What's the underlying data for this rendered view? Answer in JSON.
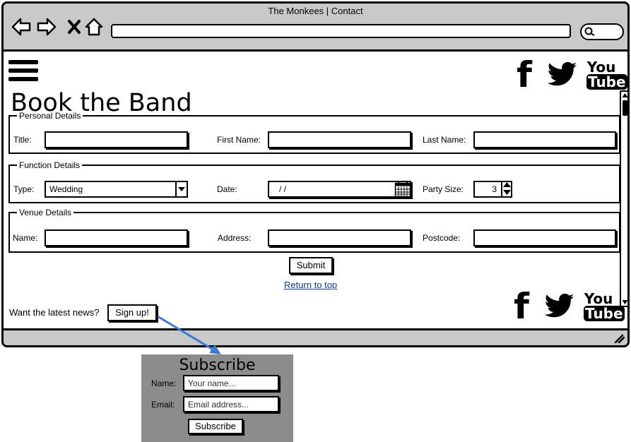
{
  "window": {
    "title": "The Monkees | Contact"
  },
  "page": {
    "title": "Book the Band"
  },
  "personal": {
    "legend": "Personal Details",
    "title_label": "Title:",
    "title_value": "",
    "first_label": "First Name:",
    "first_value": "",
    "last_label": "Last Name:",
    "last_value": ""
  },
  "function": {
    "legend": "Function Details",
    "type_label": "Type:",
    "type_value": "Wedding",
    "date_label": "Date:",
    "date_value": "/ /",
    "party_label": "Party Size:",
    "party_value": "3"
  },
  "venue": {
    "legend": "Venue Details",
    "name_label": "Name:",
    "name_value": "",
    "address_label": "Address:",
    "address_value": "",
    "postcode_label": "Postcode:",
    "postcode_value": ""
  },
  "actions": {
    "submit": "Submit",
    "return_top": "Return to top"
  },
  "news": {
    "text": "Want the latest news?",
    "signup": "Sign up!"
  },
  "social": {
    "facebook": "f",
    "youtube_top": "You",
    "youtube_bottom": "Tube"
  },
  "subscribe": {
    "title": "Subscribe",
    "name_label": "Name:",
    "name_placeholder": "Your name...",
    "email_label": "Email:",
    "email_placeholder": "Email address...",
    "button": "Subscribe"
  },
  "colors": {
    "chrome": "#c9c9c9",
    "arrow": "#3a7bd5",
    "popup_bg": "#8c8c8c",
    "link": "#0b3a8f"
  },
  "icons": [
    "back-arrow-icon",
    "forward-arrow-icon",
    "close-icon",
    "home-icon",
    "search-icon",
    "hamburger-icon",
    "facebook-icon",
    "twitter-icon",
    "youtube-icon",
    "calendar-icon",
    "chevron-down-icon",
    "resize-grip-icon"
  ]
}
